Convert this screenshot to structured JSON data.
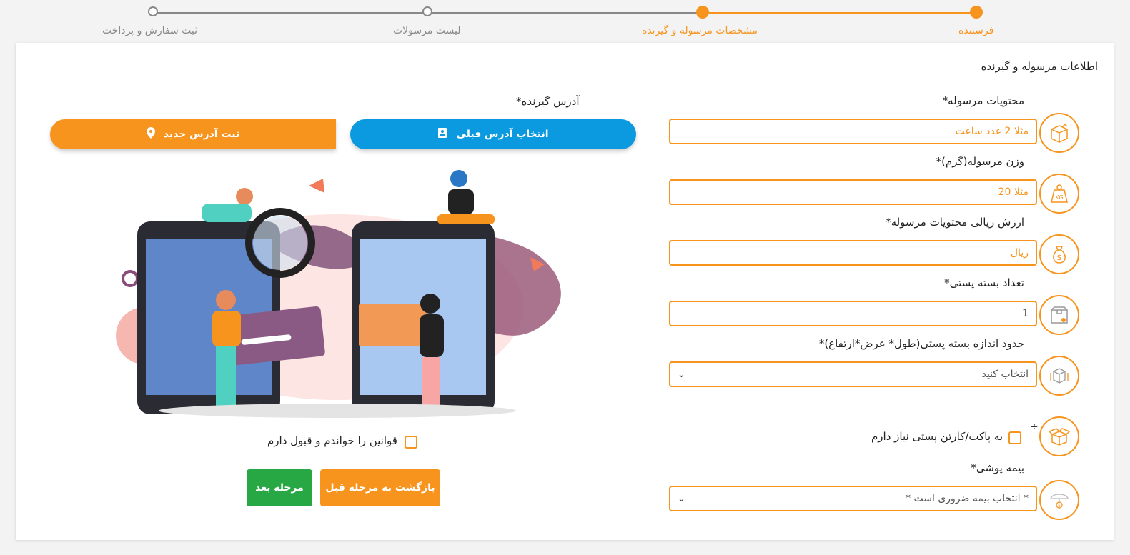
{
  "stepper": {
    "steps": [
      {
        "label": "فرستنده",
        "state": "active"
      },
      {
        "label": "مشخصات مرسوله و گیرنده",
        "state": "active"
      },
      {
        "label": "لیست مرسولات",
        "state": "inactive"
      },
      {
        "label": "ثبت سفارش و پرداخت",
        "state": "inactive"
      }
    ]
  },
  "card": {
    "title": "اطلاعات مرسوله و گیرنده"
  },
  "form": {
    "contents": {
      "label": "محتویات مرسوله*",
      "placeholder": "مثلا 2 عدد ساعت",
      "icon": "package-icon"
    },
    "weight": {
      "label": "وزن مرسوله(گرم)*",
      "placeholder": "مثلا 20",
      "icon": "kg-weight-icon"
    },
    "value": {
      "label": "ارزش ریالی محتویات مرسوله*",
      "placeholder": "ریال",
      "icon": "money-bag-icon"
    },
    "count": {
      "label": "تعداد بسته پستی*",
      "value": "1",
      "icon": "box-icon"
    },
    "dimensions": {
      "label": "حدود اندازه بسته پستی(طول* عرض*ارتفاع)*",
      "selected": "انتخاب کنید",
      "icon": "dimension-box-icon"
    },
    "packaging": {
      "label": "به پاکت/کارتن پستی نیاز دارم",
      "marker": "÷",
      "icon": "open-box-icon"
    },
    "insurance": {
      "label": "بیمه پوشی*",
      "selected": "* انتخاب بیمه ضروری است *",
      "icon": "insurance-icon"
    }
  },
  "address": {
    "label": "آدرس گیرنده*",
    "select_prev": "انتخاب آدرس قبلی",
    "new_address": "ثبت آدرس جدید"
  },
  "terms": {
    "label": "قوانین را خواندم و قبول دارم"
  },
  "buttons": {
    "back": "بازگشت به مرحله قبل",
    "next": "مرحله بعد"
  },
  "colors": {
    "accent": "#f7941d",
    "blue": "#0b9ae0",
    "green": "#28a745"
  }
}
